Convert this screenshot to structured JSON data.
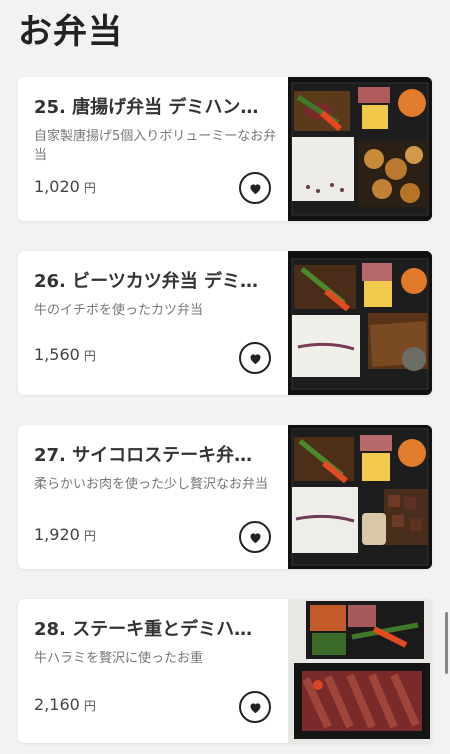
{
  "page": {
    "title": "お弁当"
  },
  "items": [
    {
      "title": "25. 唐揚げ弁当 デミハン…",
      "description": "自家製唐揚げ5個入りボリューミーなお弁当",
      "price": "1,020",
      "currency": "円",
      "image_icon": "karaage-bento-photo",
      "fav_icon": "heart-icon"
    },
    {
      "title": "26. ビーツカツ弁当 デミ…",
      "description": "牛のイチボを使ったカツ弁当",
      "price": "1,560",
      "currency": "円",
      "image_icon": "beef-katsu-bento-photo",
      "fav_icon": "heart-icon"
    },
    {
      "title": "27. サイコロステーキ弁…",
      "description": "柔らかいお肉を使った少し贅沢なお弁当",
      "price": "1,920",
      "currency": "円",
      "image_icon": "dice-steak-bento-photo",
      "fav_icon": "heart-icon"
    },
    {
      "title": "28. ステーキ重とデミハ…",
      "description": "牛ハラミを贅沢に使ったお重",
      "price": "2,160",
      "currency": "円",
      "image_icon": "steak-ju-photo",
      "fav_icon": "heart-icon"
    }
  ]
}
